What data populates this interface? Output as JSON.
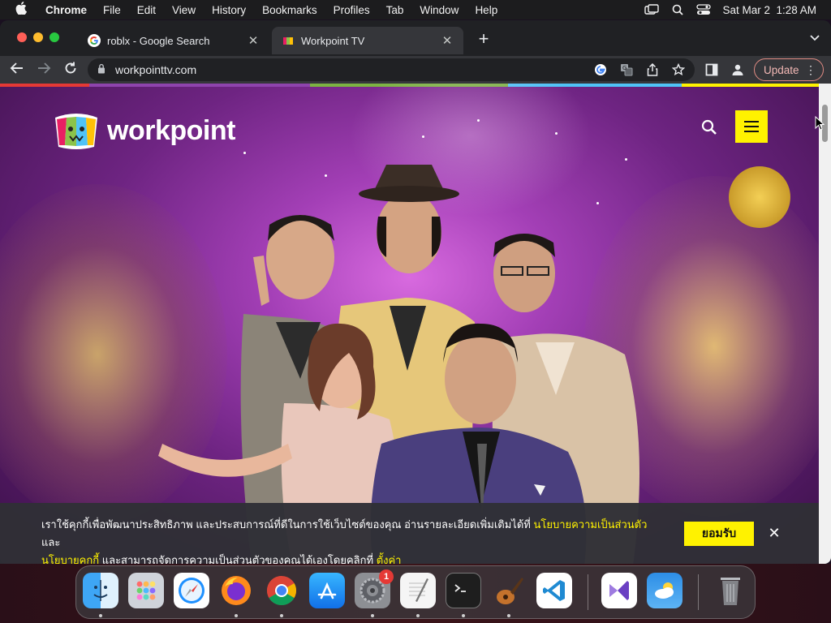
{
  "menubar": {
    "app_name": "Chrome",
    "items": [
      "File",
      "Edit",
      "View",
      "History",
      "Bookmarks",
      "Profiles",
      "Tab",
      "Window",
      "Help"
    ],
    "datetime": "Sat Mar 2  1:28 AM"
  },
  "tabs": [
    {
      "title": "roblx - Google Search",
      "active": false,
      "favicon": "google-icon"
    },
    {
      "title": "Workpoint TV",
      "active": true,
      "favicon": "workpoint-icon"
    }
  ],
  "toolbar": {
    "url": "workpointtv.com",
    "update_label": "Update"
  },
  "site": {
    "logo_text": "workpoint",
    "colorbar": [
      "#e53935",
      "#8e44ad",
      "#7cb342",
      "#4fc3f7",
      "#fff200"
    ]
  },
  "cookie": {
    "text_1": "เราใช้คุกกี้เพื่อพัฒนาประสิทธิภาพ และประสบการณ์ที่ดีในการใช้เว็บไซต์ของคุณ อ่านรายละเอียดเพิ่มเติมได้ที่",
    "link_privacy": "นโยบายความเป็นส่วนตัว",
    "text_and": "และ",
    "link_cookie": "นโยบายคุกกี้",
    "text_2": "และสามารถจัดการความเป็นส่วนตัวของคุณได้เองโดยคลิกที่",
    "link_settings": "ตั้งค่า",
    "accept_label": "ยอมรับ"
  },
  "dock": {
    "apps": [
      "Finder",
      "Launchpad",
      "Safari",
      "Firefox",
      "Chrome",
      "App Store",
      "System Settings",
      "TextEdit",
      "Terminal",
      "GarageBand",
      "Visual Studio Code",
      "Visual Studio",
      "Weather",
      "Trash"
    ],
    "settings_badge": "1"
  }
}
